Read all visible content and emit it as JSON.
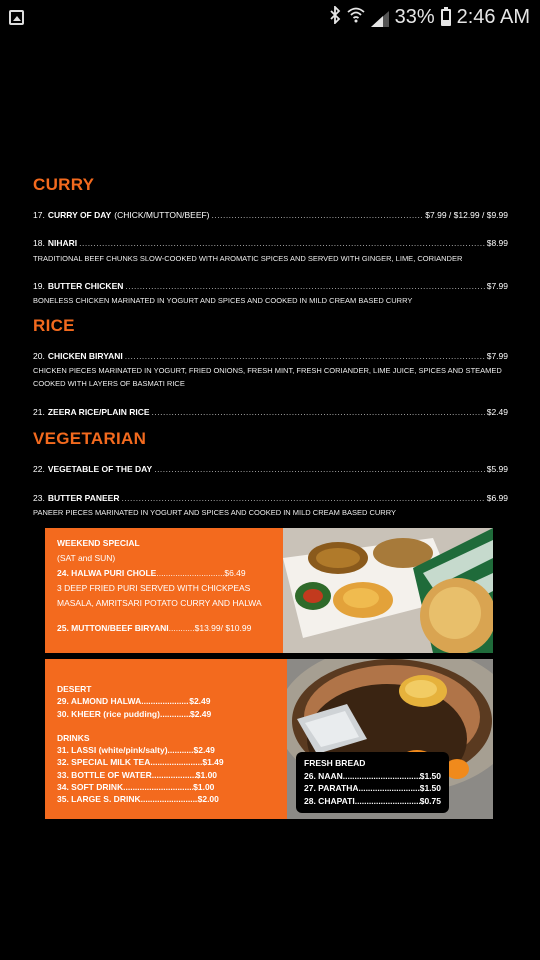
{
  "status_bar": {
    "battery": "33%",
    "time": "2:46 AM",
    "icons": [
      "gallery-icon",
      "bluetooth-icon",
      "wifi-icon",
      "signal-icon",
      "battery-icon"
    ]
  },
  "colors": {
    "accent": "#f36a1e",
    "background": "#000000"
  },
  "menu": {
    "curry": {
      "title": "CURRY",
      "items": [
        {
          "num": "17.",
          "name": "CURRY OF DAY",
          "note": "(CHICK/MUTTON/BEEF)",
          "price": "$7.99 / $12.99 / $9.99",
          "desc": ""
        },
        {
          "num": "18.",
          "name": "NIHARI",
          "note": "",
          "price": "$8.99",
          "desc": "TRADITIONAL BEEF CHUNKS SLOW-COOKED WITH AROMATIC SPICES AND SERVED WITH GINGER, LIME, CORIANDER"
        },
        {
          "num": "19.",
          "name": "BUTTER CHICKEN",
          "note": "",
          "price": "$7.99",
          "desc": "BONELESS CHICKEN MARINATED IN YOGURT AND SPICES AND COOKED IN MILD CREAM BASED CURRY"
        }
      ]
    },
    "rice": {
      "title": "RICE",
      "items": [
        {
          "num": "20.",
          "name": "CHICKEN BIRYANI",
          "note": "",
          "price": "$7.99",
          "desc": "CHICKEN PIECES MARINATED IN YOGURT, FRIED ONIONS, FRESH MINT, FRESH CORIANDER, LIME JUICE, SPICES AND STEAMED COOKED WITH LAYERS OF BASMATI RICE"
        },
        {
          "num": "21.",
          "name": "ZEERA RICE/PLAIN RICE",
          "note": "",
          "price": "$2.49",
          "desc": ""
        }
      ]
    },
    "vegetarian": {
      "title": "VEGETARIAN",
      "items": [
        {
          "num": "22.",
          "name": "VEGETABLE OF THE DAY",
          "note": "",
          "price": "$5.99",
          "desc": ""
        },
        {
          "num": "23.",
          "name": "BUTTER PANEER",
          "note": "",
          "price": "$6.99",
          "desc": "PANEER PIECES MARINATED IN YOGURT AND SPICES AND COOKED IN MILD CREAM BASED CURRY"
        }
      ]
    }
  },
  "weekend": {
    "title": "WEEKEND SPECIAL",
    "subtitle": "(SAT and SUN)",
    "item24": {
      "label": "24. HALWA PURI CHOLE",
      "price": "$6.49"
    },
    "desc1": "3 DEEP FRIED PURI SERVED WITH CHICKPEAS",
    "desc2": "MASALA, AMRITSARI POTATO CURRY AND HALWA",
    "item25": {
      "label": "25. MUTTON/BEEF BIRYANI",
      "price": "$13.99/ $10.99"
    }
  },
  "desert": {
    "title": "DESERT",
    "items": [
      {
        "label": "29. ALMOND HALWA",
        "price": "$2.49"
      },
      {
        "label": "30. KHEER (rice pudding)",
        "price": "$2.49"
      }
    ]
  },
  "drinks": {
    "title": "DRINKS",
    "items": [
      {
        "label": "31. LASSI (white/pink/salty)",
        "price": "$2.49"
      },
      {
        "label": "32. SPECIAL MILK TEA",
        "price": "$1.49"
      },
      {
        "label": "33. BOTTLE OF WATER",
        "price": "$1.00"
      },
      {
        "label": "34. SOFT DRINK",
        "price": "$1.00"
      },
      {
        "label": "35. LARGE S. DRINK",
        "price": "$2.00"
      }
    ]
  },
  "bread": {
    "title": "FRESH BREAD",
    "items": [
      {
        "label": "26. NAAN",
        "price": "$1.50"
      },
      {
        "label": "27. PARATHA",
        "price": "$1.50"
      },
      {
        "label": "28. CHAPATI",
        "price": "$0.75"
      }
    ]
  }
}
